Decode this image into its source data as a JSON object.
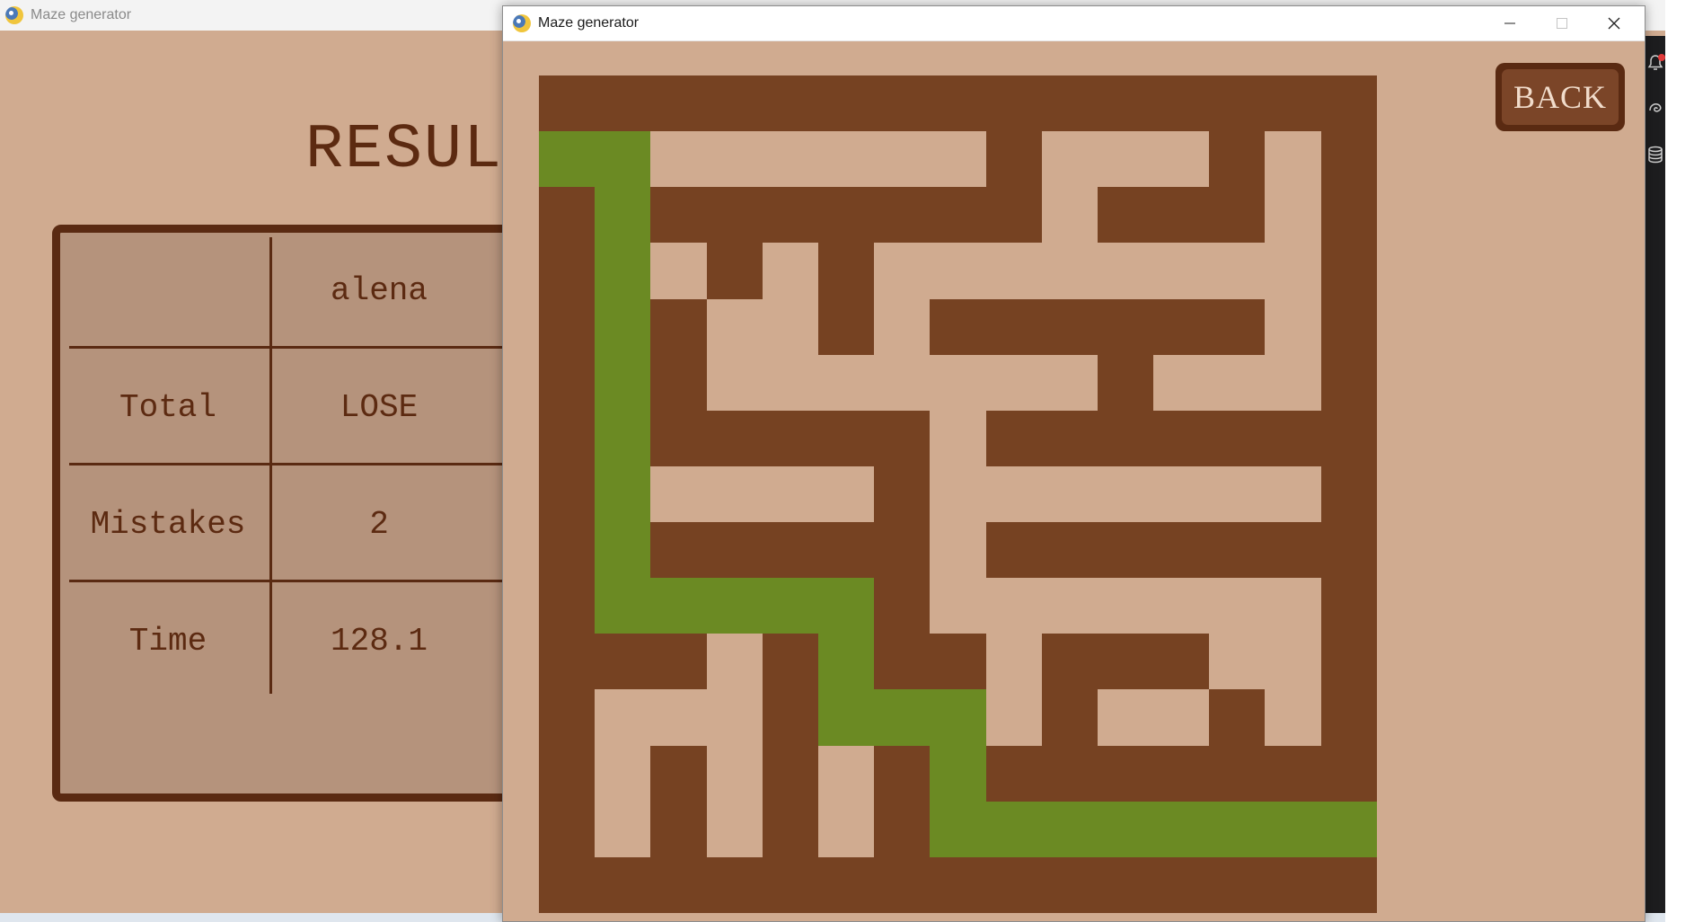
{
  "background_window": {
    "title": "Maze generator",
    "heading": "RESULTS",
    "table": {
      "header": [
        "",
        "alena"
      ],
      "rows": [
        {
          "label": "Total",
          "value": "LOSE"
        },
        {
          "label": "Mistakes",
          "value": "2"
        },
        {
          "label": "Time",
          "value": "128.1"
        }
      ]
    }
  },
  "maze_window": {
    "title": "Maze generator",
    "back_label": "BACK",
    "controls": {
      "minimize": "minimize-icon",
      "maximize": "maximize-icon",
      "close": "close-icon"
    },
    "colors": {
      "wall": "#764222",
      "path": "#d0ab90",
      "solution": "#6b8a23",
      "background": "#d0ab90"
    },
    "maze": [
      "WWWWWWWWWWWWWWW",
      "SSPPPPPPWPPPWPW",
      "WSWWWWWWWPWWWPW",
      "WSPWPWPPPPPPPPW",
      "WSWPPWPWWWWWWPW",
      "WSWPPPPPPPWPPPW",
      "WSWWWWWPWWWWWWW",
      "WSPPPPWPPPPPPPW",
      "WSWWWWWPWWWWWWW",
      "WSSSSSWPPPPPPPW",
      "WWWPWSWWPWWWPPW",
      "WPPPWSSSPWPPWPW",
      "WPWPWPWSWWWWWWW",
      "WPWPWPWSSSSSSSS",
      "WWWWWWWWWWWWWWW"
    ]
  },
  "side_icons": [
    "bell-icon",
    "spiral-icon",
    "database-icon"
  ]
}
